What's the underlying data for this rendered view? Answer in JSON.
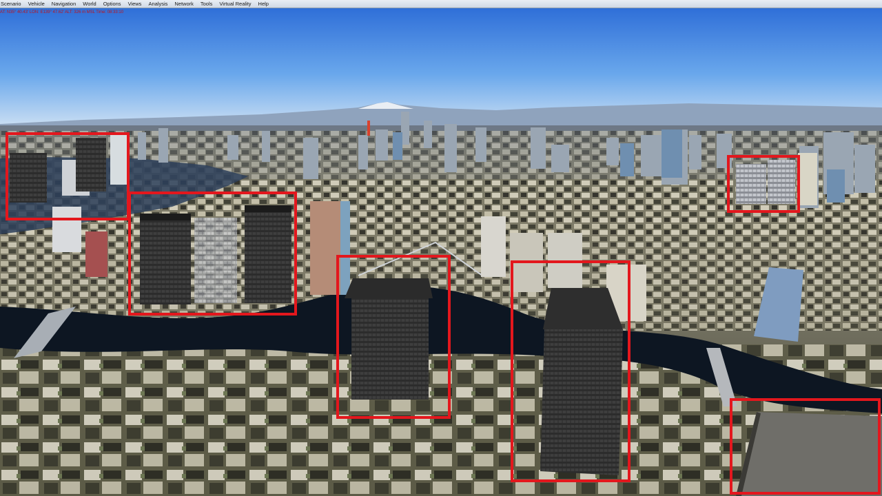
{
  "menu": [
    "Scenario",
    "Vehicle",
    "Navigation",
    "World",
    "Options",
    "Views",
    "Analysis",
    "Network",
    "Tools",
    "Virtual Reality",
    "Help"
  ],
  "status_line": "AT: N35° 40.43'  LON: E139° 47.62'  ALT: 326 m  MSL  Time: 08:33:10",
  "colors": {
    "highlight": "#e3171d",
    "status_text": "#c0141a",
    "sky_top": "#2f6fd8",
    "sky_horizon": "#cfe1f3",
    "river": "#0d1622"
  },
  "highlight_boxes": [
    "highlight-box-1",
    "highlight-box-2",
    "highlight-box-3",
    "highlight-box-4",
    "highlight-box-5",
    "highlight-box-6"
  ]
}
